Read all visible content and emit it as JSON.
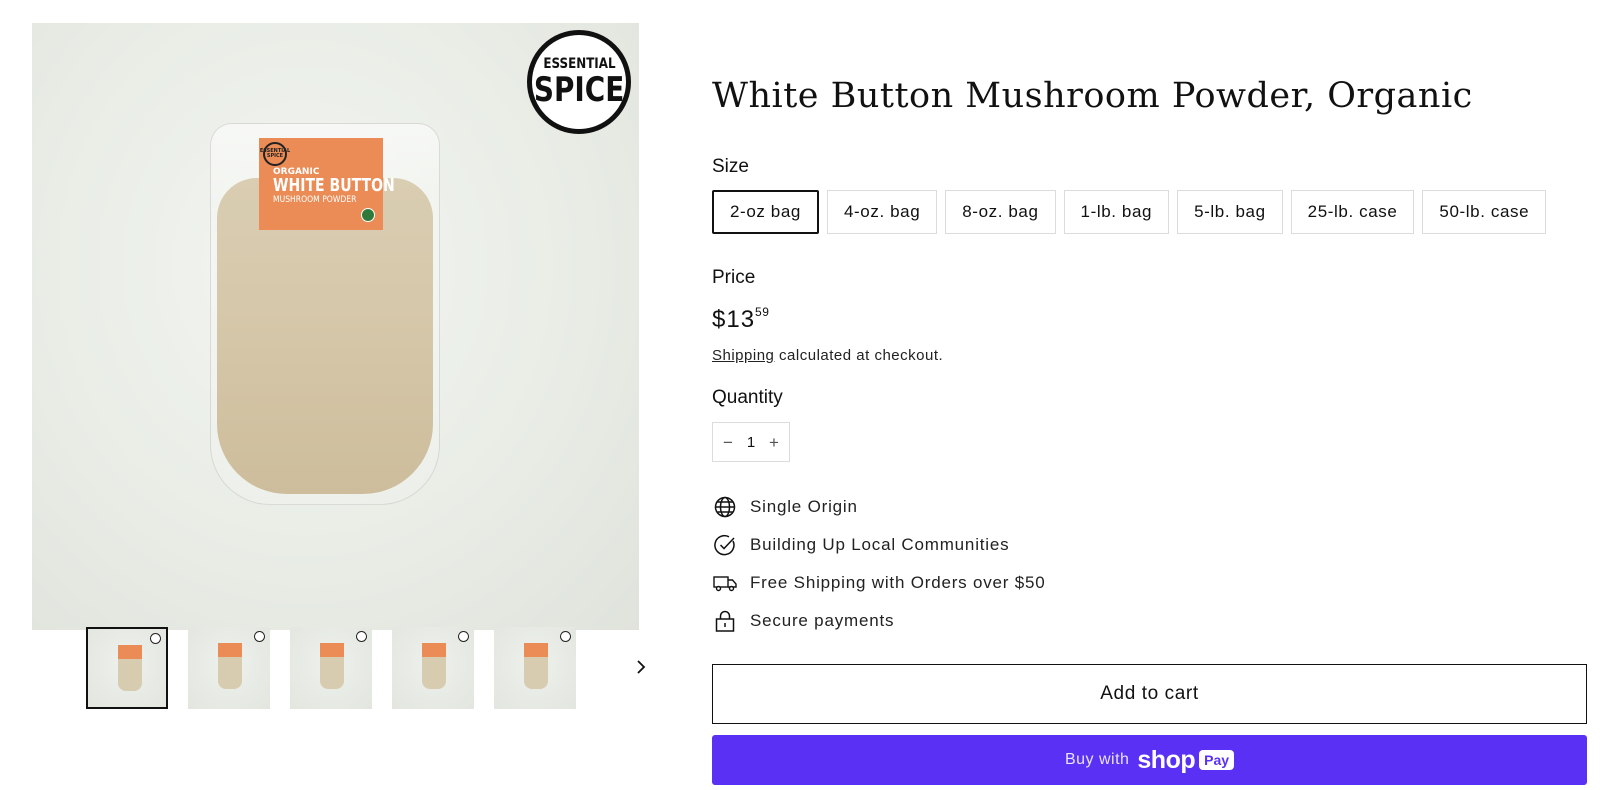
{
  "gallery": {
    "brand_logo": {
      "line1": "ESSENTIAL",
      "line2": "SPICE"
    },
    "bag_label": {
      "seal_text": "ESSENTIAL SPICE",
      "line1": "ORGANIC",
      "line2": "WHITE BUTTON",
      "line3": "MUSHROOM POWDER"
    },
    "thumbnail_count": 5,
    "next_icon": "chevron-right-icon"
  },
  "product": {
    "title": "White Button Mushroom Powder, Organic",
    "size_label": "Size",
    "sizes": [
      {
        "label": "2-oz bag",
        "selected": true
      },
      {
        "label": "4-oz. bag",
        "selected": false
      },
      {
        "label": "8-oz. bag",
        "selected": false
      },
      {
        "label": "1-lb. bag",
        "selected": false
      },
      {
        "label": "5-lb. bag",
        "selected": false
      },
      {
        "label": "25-lb. case",
        "selected": false
      },
      {
        "label": "50-lb. case",
        "selected": false
      }
    ],
    "price_label": "Price",
    "price_main": "$13",
    "price_cents": "59",
    "shipping_link": "Shipping",
    "shipping_text": " calculated at checkout.",
    "quantity_label": "Quantity",
    "quantity": {
      "minus": "−",
      "value": "1",
      "plus": "+"
    },
    "features": [
      {
        "icon": "globe-icon",
        "text": "Single Origin"
      },
      {
        "icon": "check-circle-icon",
        "text": "Building Up Local Communities"
      },
      {
        "icon": "truck-icon",
        "text": "Free Shipping with Orders over $50"
      },
      {
        "icon": "lock-icon",
        "text": "Secure payments"
      }
    ],
    "add_to_cart": "Add to cart",
    "shop_pay": {
      "buy_with": "Buy with",
      "shop": "shop",
      "pay": "Pay"
    }
  },
  "colors": {
    "shop_pay_purple": "#5a31f4",
    "label_orange": "#eb8b55",
    "text": "#111111",
    "border": "#dcdcdc"
  }
}
